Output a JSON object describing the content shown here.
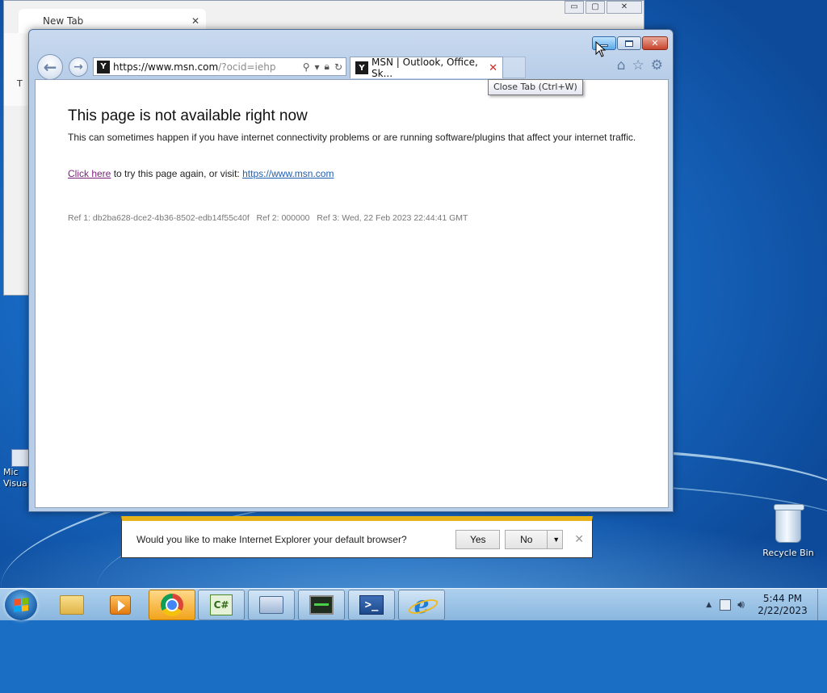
{
  "background_window": {
    "tab_title": "New Tab",
    "tab_close": "✕",
    "side_text": "T",
    "controls": [
      "▭",
      "▢",
      "✕"
    ]
  },
  "desktop": {
    "partial_icon_label_line1": "Mic",
    "partial_icon_label_line2": "Visua",
    "recycle_bin_label": "Recycle Bin"
  },
  "browser": {
    "address": {
      "url_host": "https://www.msn.com",
      "url_rest": "/?ocid=iehp",
      "favicon": "Y"
    },
    "tab": {
      "title": "MSN | Outlook, Office, Sk...",
      "close": "✕"
    },
    "tooltip": "Close Tab (Ctrl+W)",
    "page": {
      "heading": "This page is not available right now",
      "description": "This can sometimes happen if you have internet connectivity problems or are running software/plugins that affect your internet traffic.",
      "retry_link": "Click here",
      "retry_middle": " to try this page again, or visit: ",
      "msn_link": "https://www.msn.com",
      "ref1": "Ref 1: db2ba628-dce2-4b36-8502-edb14f55c40f",
      "ref2": "Ref 2: 000000",
      "ref3": "Ref 3: Wed, 22 Feb 2023 22:44:41 GMT"
    },
    "notification": {
      "message": "Would you like to make Internet Explorer your default browser?",
      "yes": "Yes",
      "no": "No",
      "dropdown": "▼",
      "close": "✕"
    }
  },
  "taskbar": {
    "apps": [
      {
        "name": "file-explorer"
      },
      {
        "name": "media-player"
      },
      {
        "name": "chrome",
        "active": true
      },
      {
        "name": "csharp",
        "label": "C#"
      },
      {
        "name": "on-screen-keyboard"
      },
      {
        "name": "resource-monitor"
      },
      {
        "name": "powershell",
        "label": ">_"
      },
      {
        "name": "internet-explorer",
        "label": "e"
      }
    ],
    "clock": {
      "time": "5:44 PM",
      "date": "2/22/2023"
    }
  },
  "colors": {
    "notification_accent": "#e5b21a",
    "visited_link": "#7a1f7a",
    "link": "#1f5fb2",
    "tab_close": "#d8241a"
  }
}
